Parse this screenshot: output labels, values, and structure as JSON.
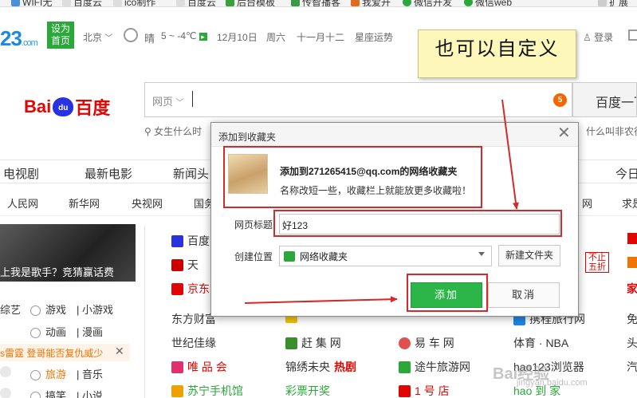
{
  "bookmarks": [
    "WIFI无",
    "百度云",
    "ico制作_",
    "百度云",
    "后台模板",
    "传智播客",
    "我爱开",
    "微信开发",
    "微信web",
    "扩展"
  ],
  "hao123": {
    "logo": "23",
    "logo_suffix": ".com",
    "home_btn": "设为\n首页",
    "city": "北京",
    "weather": "晴",
    "temp": "5 ~ -4℃",
    "date": "12月10日",
    "weekday": "周六",
    "lunar": "十一月十二",
    "constellation": "星座运势",
    "login": "登录"
  },
  "baidu": {
    "logo_left": "Bai",
    "logo_paw": "du",
    "logo_right": "百度",
    "search_category": "网页",
    "hot_count": "5",
    "search_button": "百度一下",
    "hint_left": "女生什么时",
    "hint_right": "什么叫非农行"
  },
  "nav1": [
    "电视剧",
    "最新电影",
    "新闻头",
    "今日"
  ],
  "nav2": [
    "人民网",
    "新华网",
    "央视网",
    "国务",
    "网",
    "求是"
  ],
  "left": {
    "promo_text": "上我是歌手？竞猜赢话费",
    "rows": [
      {
        "a": "综艺",
        "b": "游戏",
        "c": "小游戏"
      },
      {
        "a": "",
        "b": "动画",
        "c": "漫画"
      },
      {
        "a": "",
        "b": "旅游",
        "c": "音乐"
      },
      {
        "a": "",
        "b": "搞笑",
        "c": "小说"
      }
    ],
    "news": "s雷霆 登哥能否复仇威少",
    "news_close": "✕"
  },
  "sites": [
    {
      "name": "百度",
      "color": "#333333"
    },
    {
      "name": "天",
      "color": "#333333"
    },
    {
      "name": "京东",
      "color": "#e10602"
    },
    {
      "name": "东方财富",
      "color": "#333333"
    },
    {
      "name": "世纪佳缘",
      "color": "#333333"
    },
    {
      "name": "唯 品 会",
      "color": "#e10602"
    },
    {
      "name": "苏宁手机馆",
      "color": "#2aa83a"
    },
    {
      "name": "赶 集 网",
      "color": "#333333"
    },
    {
      "name": "锦绣未央",
      "color": "#333333"
    },
    {
      "name": "热剧",
      "color": "#e10602"
    },
    {
      "name": "彩票开奖",
      "color": "#2aa83a"
    },
    {
      "name": "易 车 网",
      "color": "#333333"
    },
    {
      "name": "途牛旅游网",
      "color": "#333333"
    },
    {
      "name": "1 号 店",
      "color": "#e10602"
    },
    {
      "name": "携程旅行网",
      "color": "#333333"
    },
    {
      "name": "体育 · NBA",
      "color": "#333333"
    },
    {
      "name": "hao123浏览器",
      "color": "#333333"
    },
    {
      "name": "hao 到 家",
      "color": "#2aa83a"
    },
    {
      "name": "家",
      "color": "#e10602"
    },
    {
      "name": "免",
      "color": "#333333"
    },
    {
      "name": "头",
      "color": "#333333"
    },
    {
      "name": "汽",
      "color": "#333333"
    },
    {
      "name": "不止\n五折",
      "color": "#e10602"
    }
  ],
  "dialog": {
    "title": "添加到收藏夹",
    "close": "✕",
    "main_text": "添加到271265415@qq.com的网络收藏夹",
    "sub_text": "名称改短一些，收藏栏上就能放更多收藏啦！",
    "label_title": "网页标题",
    "title_value": "好123",
    "label_location": "创建位置",
    "location_value": "网络收藏夹",
    "new_folder": "新建文件夹",
    "add": "添加",
    "cancel": "取消"
  },
  "annotation": {
    "callout": "也可以自定义",
    "color": "#d42a2a"
  },
  "watermark": {
    "main": "Bai经验",
    "sub": "jingyan.baidu.com"
  }
}
